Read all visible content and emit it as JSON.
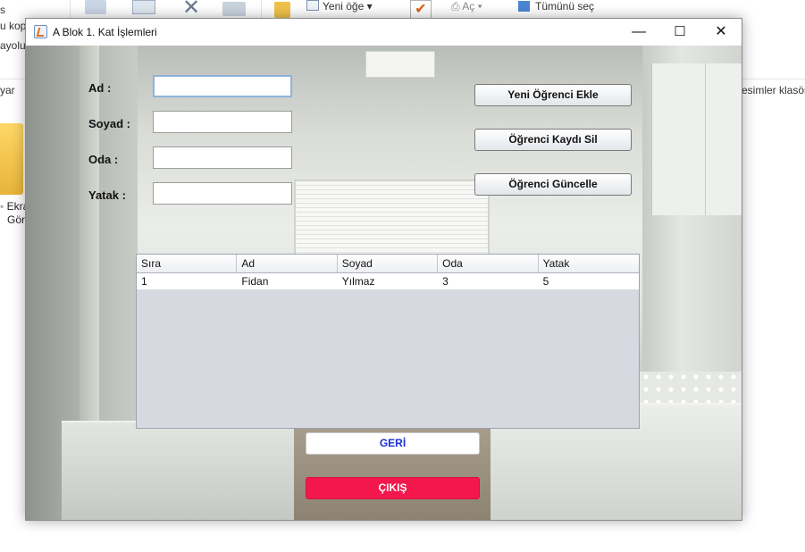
{
  "background_explorer": {
    "ribbon": {
      "new_item_label": "Yeni öğe",
      "open_label": "Aç",
      "select_all_label": "Tümünü seç",
      "copy_fragment": "u kop",
      "path_fragment": "ayolu",
      "s_fragment": "s"
    },
    "address": {
      "left_fragment": "yar",
      "right_fragment": "esimler klasör"
    },
    "desktop_item": {
      "label_line1": "Ekra",
      "label_line2": "Görü"
    }
  },
  "window": {
    "title": "A Blok 1. Kat İşlemleri",
    "controls": {
      "minimize": "—",
      "maximize": "☐",
      "close": "✕"
    }
  },
  "form": {
    "ad_label": "Ad :",
    "soyad_label": "Soyad :",
    "oda_label": "Oda :",
    "yatak_label": "Yatak :",
    "ad_value": "",
    "soyad_value": "",
    "oda_value": "",
    "yatak_value": ""
  },
  "actions": {
    "add_label": "Yeni Öğrenci Ekle",
    "delete_label": "Öğrenci Kaydı Sil",
    "update_label": "Öğrenci Güncelle"
  },
  "table": {
    "columns": [
      "Sıra",
      "Ad",
      "Soyad",
      "Oda",
      "Yatak"
    ],
    "rows": [
      [
        "1",
        "Fidan",
        "Yılmaz",
        "3",
        "5"
      ]
    ]
  },
  "nav": {
    "back_label": "GERİ",
    "exit_label": "ÇIKIŞ"
  },
  "colors": {
    "exit_button": "#f3174d",
    "back_text": "#1c2fd8"
  }
}
